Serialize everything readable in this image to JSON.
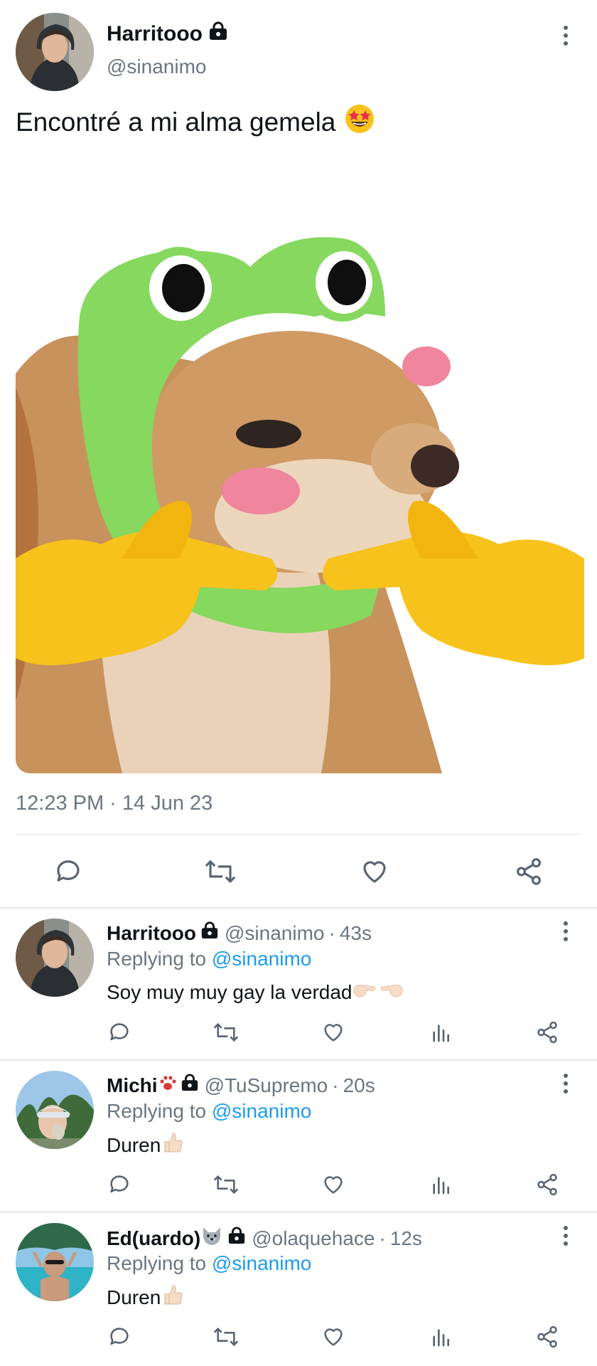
{
  "main_tweet": {
    "display_name": "Harritooo",
    "handle": "@sinanimo",
    "text": "Encontré a mi alma gemela",
    "text_emoji": "star-struck-emoji",
    "timestamp": "12:23 PM · 14 Jun 23",
    "media_description": "shiba-frog-hat-meme",
    "actions": [
      "reply-icon",
      "retweet-icon",
      "like-icon",
      "share-icon"
    ]
  },
  "replies": [
    {
      "display_name": "Harritooo",
      "handle": "@sinanimo",
      "separator": "·",
      "time": "43s",
      "replying_label": "Replying to",
      "replying_to": "@sinanimo",
      "text": "Soy muy muy gay la verdad",
      "text_emoji": "pointing-fingers-emoji"
    },
    {
      "display_name": "Michi",
      "name_emoji": "paw-emoji",
      "handle": "@TuSupremo",
      "separator": "·",
      "time": "20s",
      "replying_label": "Replying to",
      "replying_to": "@sinanimo",
      "text": "Duren",
      "text_emoji": "thumbs-up-emoji"
    },
    {
      "display_name": "Ed(uardo)",
      "name_emoji": "wolf-emoji",
      "handle": "@olaquehace",
      "separator": "·",
      "time": "12s",
      "replying_label": "Replying to",
      "replying_to": "@sinanimo",
      "text": "Duren",
      "text_emoji": "thumbs-up-emoji"
    }
  ],
  "colors": {
    "text_primary": "#0f1419",
    "text_secondary": "#6b7682",
    "link": "#1d9bf0",
    "divider": "#e6e9ec",
    "icon": "#596471",
    "frog_green": "#86d85e",
    "emoji_yellow": "#f7c21b"
  }
}
